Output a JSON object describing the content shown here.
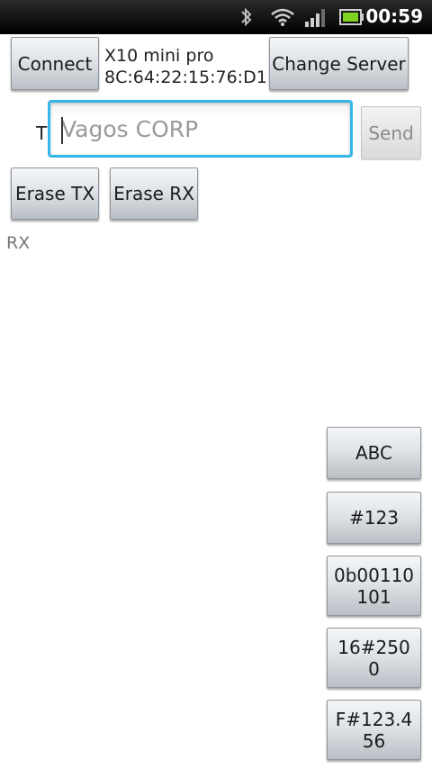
{
  "status_bar": {
    "time": "00:59",
    "icons": [
      "bluetooth-icon",
      "wifi-icon",
      "signal-icon",
      "battery-icon"
    ]
  },
  "toolbar": {
    "connect_label": "Connect",
    "device_name": "X10 mini pro",
    "device_address": "8C:64:22:15:76:D1",
    "change_server_label": "Change Server"
  },
  "send_row": {
    "t_label": "T",
    "input_value": "Vagos CORP",
    "send_label": "Send"
  },
  "erase": {
    "erase_tx_label": "Erase TX",
    "erase_rx_label": "Erase RX"
  },
  "rx": {
    "label": "RX"
  },
  "format_buttons": {
    "abc": "ABC",
    "num": "#123",
    "bin_line1": "0b00110",
    "bin_line2": "101",
    "hex_line1": "16#250",
    "hex_line2": "0",
    "float_line1": "F#123.4",
    "float_line2": "56"
  },
  "colors": {
    "focus_border": "#35b6e8",
    "status_bar": "#000000"
  }
}
